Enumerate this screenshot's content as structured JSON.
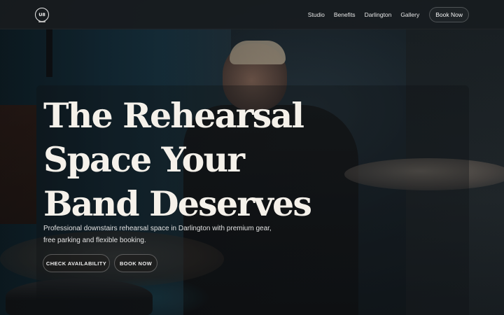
{
  "nav": {
    "logo_text": "U8",
    "links": [
      "Studio",
      "Benefits",
      "Darlington",
      "Gallery"
    ],
    "cta": "Book Now"
  },
  "hero": {
    "headline_lines": [
      "The Rehearsal",
      "Space Your",
      "Band Deserves"
    ],
    "subtitle_line1": "Professional downstairs rehearsal space in Darlington with premium gear,",
    "subtitle_line2": "free parking and flexible booking.",
    "primary_button": "CHECK AVAILABILITY",
    "secondary_button": "BOOK NOW"
  },
  "colors": {
    "headline": "#f5f1ea",
    "navbar_bg": "#181c1f",
    "button_bg": "#1e1c1a"
  }
}
